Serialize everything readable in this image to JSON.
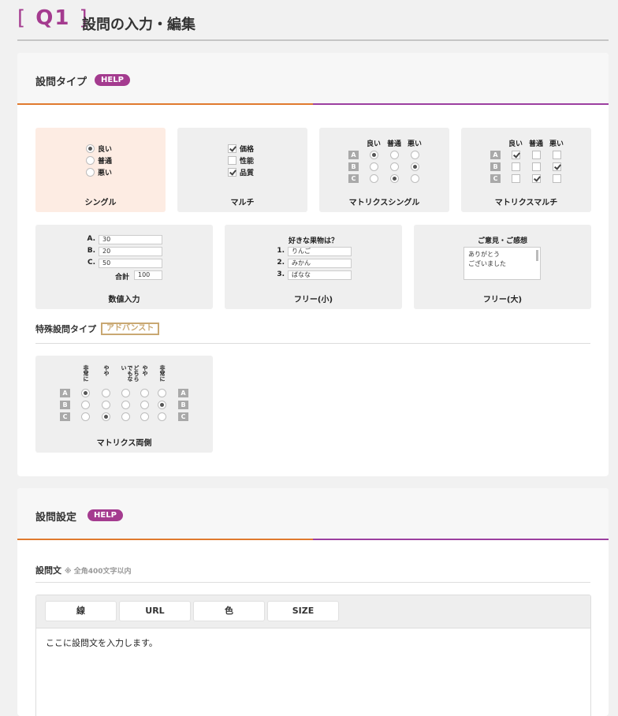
{
  "header": {
    "q_number": "Q1",
    "title": "設問の入力・編集"
  },
  "question_type": {
    "title": "設問タイプ",
    "help": "HELP",
    "cards": {
      "single": {
        "label": "シングル",
        "options": [
          "良い",
          "普通",
          "悪い"
        ]
      },
      "multi": {
        "label": "マルチ",
        "options": [
          "価格",
          "性能",
          "品質"
        ]
      },
      "matrix_single": {
        "label": "マトリクスシングル",
        "cols": [
          "良い",
          "普通",
          "悪い"
        ],
        "rows": [
          "A",
          "B",
          "C"
        ]
      },
      "matrix_multi": {
        "label": "マトリクスマルチ",
        "cols": [
          "良い",
          "普通",
          "悪い"
        ],
        "rows": [
          "A",
          "B",
          "C"
        ]
      },
      "numeric": {
        "label": "数値入力",
        "rows": [
          {
            "key": "A.",
            "value": "30"
          },
          {
            "key": "B.",
            "value": "20"
          },
          {
            "key": "C.",
            "value": "50"
          }
        ],
        "total_label": "合計",
        "total_value": "100"
      },
      "free_small": {
        "label": "フリー(小)",
        "question": "好きな果物は？",
        "rows": [
          {
            "key": "1.",
            "value": "りんご"
          },
          {
            "key": "2.",
            "value": "みかん"
          },
          {
            "key": "3.",
            "value": "ばなな"
          }
        ]
      },
      "free_large": {
        "label": "フリー(大)",
        "question": "ご意見・ご感想",
        "line1": "ありがとう",
        "line2": "ございました"
      }
    },
    "special": {
      "title": "特殊設問タイプ",
      "badge": "アドバンスト",
      "matrix_both": {
        "label": "マトリクス両側",
        "cols": [
          "非常に",
          "やや",
          "どちらでもない",
          "やや",
          "非常に"
        ],
        "rows": [
          "A",
          "B",
          "C"
        ]
      }
    }
  },
  "question_settings": {
    "title": "設問設定",
    "help": "HELP",
    "text_label": "設問文",
    "text_note": "※ 全角400文字以内",
    "toolbar": [
      "線",
      "URL",
      "色",
      "SIZE"
    ],
    "editor_text": "ここに設問文を入力します。"
  }
}
